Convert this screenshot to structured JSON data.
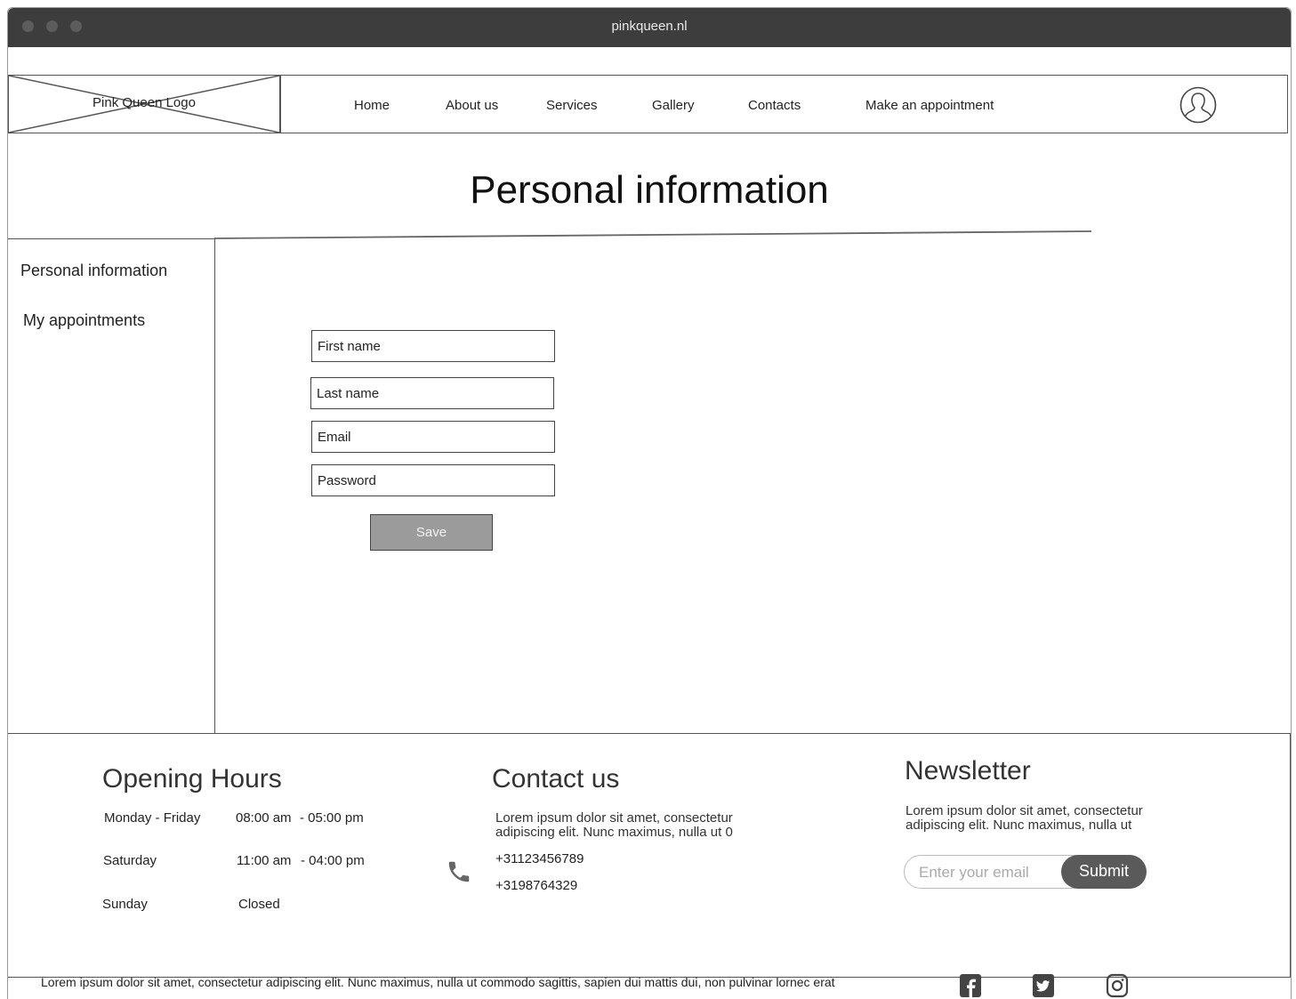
{
  "browser": {
    "url": "pinkqueen.nl"
  },
  "nav": {
    "logo_text": "Pink Queen Logo",
    "links": [
      "Home",
      "About us",
      "Services",
      "Gallery",
      "Contacts",
      "Make an appointment"
    ],
    "profile_icon": "user-circle-icon"
  },
  "page": {
    "title": "Personal information"
  },
  "sidebar": {
    "items": [
      "Personal information",
      "My appointments"
    ]
  },
  "form": {
    "first_name_placeholder": "First name",
    "last_name_placeholder": "Last name",
    "email_placeholder": "Email",
    "password_placeholder": "Password",
    "save_label": "Save"
  },
  "footer": {
    "hours": {
      "title": "Opening Hours",
      "rows": [
        {
          "day": "Monday - Friday",
          "open": "08:00 am",
          "close": "- 05:00 pm"
        },
        {
          "day": "Saturday",
          "open": "11:00 am",
          "close": "- 04:00 pm"
        },
        {
          "day": "Sunday",
          "open": "Closed",
          "close": ""
        }
      ]
    },
    "contact": {
      "title": "Contact us",
      "text_line1": "Lorem ipsum dolor sit amet, consectetur",
      "text_line2": "adipiscing elit. Nunc maximus, nulla ut 0",
      "phone1": "+31123456789",
      "phone2": "+3198764329",
      "phone_icon": "phone-icon"
    },
    "newsletter": {
      "title": "Newsletter",
      "text_line1": "Lorem ipsum dolor sit amet, consectetur",
      "text_line2": "adipiscing elit. Nunc maximus, nulla ut",
      "email_placeholder": "Enter your email",
      "submit_label": "Submit"
    }
  },
  "bottom_bar": {
    "text": "Lorem ipsum dolor sit amet, consectetur adipiscing elit. Nunc maximus, nulla ut commodo sagittis, sapien dui mattis dui, non pulvinar lornec erat",
    "social_icons": [
      "facebook-icon",
      "twitter-icon",
      "instagram-icon"
    ]
  },
  "colors": {
    "titlebar": "#3d3d3d",
    "save_button": "#9b9b9b",
    "submit_button": "#5a5a5a",
    "border": "#555555"
  }
}
